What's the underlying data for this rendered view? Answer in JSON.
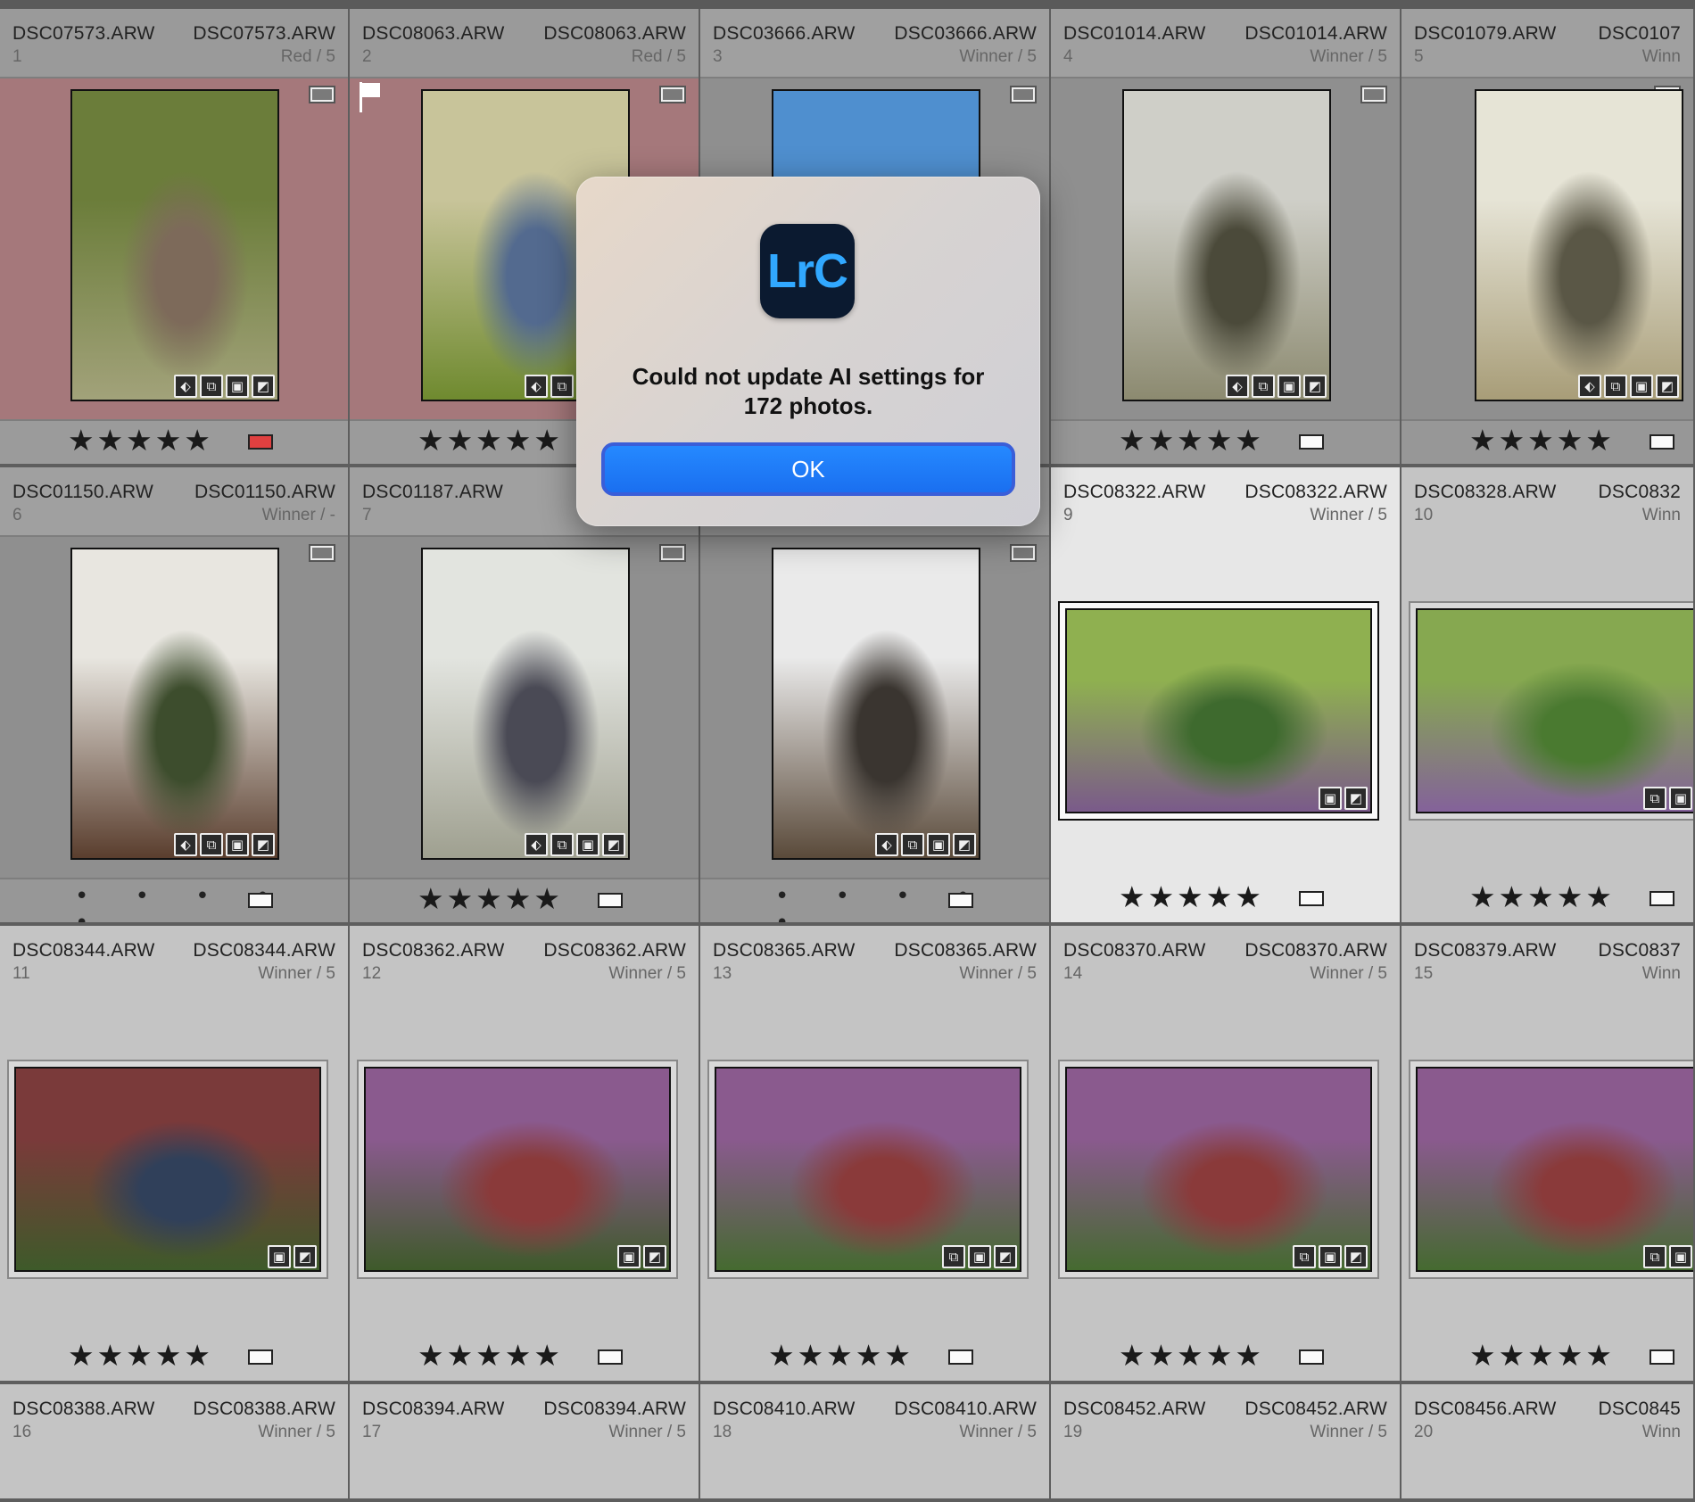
{
  "dialog": {
    "app_icon_text": "LrC",
    "message_line1": "Could not update AI settings for",
    "message_line2": "172 photos.",
    "ok_label": "OK"
  },
  "grid": {
    "cells": [
      {
        "row": 0,
        "col": 0,
        "file": "DSC07573.ARW",
        "file_right": "DSC07573.ARW",
        "index": "1",
        "label": "Red / 5",
        "rating": "★★★★★",
        "footer": "stars",
        "swatch": "red",
        "orientation": "portrait",
        "state": "red",
        "colors": [
          "#6b7d3a",
          "#a2a27a",
          "#7d6a5a"
        ],
        "flagged": false
      },
      {
        "row": 0,
        "col": 1,
        "file": "DSC08063.ARW",
        "file_right": "DSC08063.ARW",
        "index": "2",
        "label": "Red / 5",
        "rating": "★★★★★",
        "footer": "stars",
        "swatch": "",
        "orientation": "portrait",
        "state": "red",
        "colors": [
          "#c8c49a",
          "#6f8a2f",
          "#536a8f"
        ],
        "flagged": true
      },
      {
        "row": 0,
        "col": 2,
        "file": "DSC03666.ARW",
        "file_right": "DSC03666.ARW",
        "index": "3",
        "label": "Winner / 5",
        "rating": "",
        "footer": "none",
        "swatch": "",
        "orientation": "portrait",
        "state": "dark",
        "colors": [
          "#4f8fcf",
          "#2f4a2a",
          "#8a8a80"
        ],
        "flagged": false
      },
      {
        "row": 0,
        "col": 3,
        "file": "DSC01014.ARW",
        "file_right": "DSC01014.ARW",
        "index": "4",
        "label": "Winner / 5",
        "rating": "★★★★★",
        "footer": "stars",
        "swatch": "box",
        "orientation": "portrait",
        "state": "dark",
        "colors": [
          "#cfcfc8",
          "#8c8a70",
          "#4b4a3a"
        ],
        "flagged": false
      },
      {
        "row": 0,
        "col": 4,
        "file": "DSC01079.ARW",
        "file_right": "DSC0107",
        "index": "5",
        "label": "Winn",
        "rating": "★★★★★",
        "footer": "stars",
        "swatch": "box",
        "orientation": "portrait",
        "state": "dark",
        "colors": [
          "#e6e4d6",
          "#a89d78",
          "#5a5746"
        ],
        "flagged": false
      },
      {
        "row": 1,
        "col": 0,
        "file": "DSC01150.ARW",
        "file_right": "DSC01150.ARW",
        "index": "6",
        "label": "Winner / -",
        "rating": "• • • • •",
        "footer": "dots",
        "swatch": "box",
        "orientation": "portrait",
        "state": "dark",
        "colors": [
          "#e8e6e0",
          "#5a3e2e",
          "#3d4d2d"
        ],
        "flagged": false
      },
      {
        "row": 1,
        "col": 1,
        "file": "DSC01187.ARW",
        "file_right": "D",
        "index": "7",
        "label": "",
        "rating": "★★★★★",
        "footer": "stars",
        "swatch": "box",
        "orientation": "portrait",
        "state": "dark",
        "colors": [
          "#e2e4df",
          "#9fa090",
          "#4a4a55"
        ],
        "flagged": false
      },
      {
        "row": 1,
        "col": 2,
        "file": "",
        "file_right": "",
        "index": "",
        "label": "",
        "rating": "• • • • •",
        "footer": "dots",
        "swatch": "box",
        "orientation": "portrait",
        "state": "dark",
        "colors": [
          "#eaeaea",
          "#5a4a3a",
          "#3a3530"
        ],
        "flagged": false
      },
      {
        "row": 1,
        "col": 3,
        "file": "DSC08322.ARW",
        "file_right": "DSC08322.ARW",
        "index": "9",
        "label": "Winner / 5",
        "rating": "★★★★★",
        "footer": "stars",
        "swatch": "box",
        "orientation": "landscape",
        "state": "selected",
        "colors": [
          "#8fb050",
          "#7a5a8a",
          "#3e6a2e"
        ],
        "flagged": false
      },
      {
        "row": 1,
        "col": 4,
        "file": "DSC08328.ARW",
        "file_right": "DSC0832",
        "index": "10",
        "label": "Winn",
        "rating": "★★★★★",
        "footer": "stars",
        "swatch": "box",
        "orientation": "landscape",
        "state": "light",
        "colors": [
          "#86a850",
          "#84629a",
          "#4a7a30"
        ],
        "flagged": false
      },
      {
        "row": 2,
        "col": 0,
        "file": "DSC08344.ARW",
        "file_right": "DSC08344.ARW",
        "index": "11",
        "label": "Winner / 5",
        "rating": "★★★★★",
        "footer": "stars",
        "swatch": "box",
        "orientation": "landscape",
        "state": "light",
        "colors": [
          "#7a3a3a",
          "#3e5a2a",
          "#30405a"
        ],
        "flagged": false
      },
      {
        "row": 2,
        "col": 1,
        "file": "DSC08362.ARW",
        "file_right": "DSC08362.ARW",
        "index": "12",
        "label": "Winner / 5",
        "rating": "★★★★★",
        "footer": "stars",
        "swatch": "box",
        "orientation": "landscape",
        "state": "light",
        "colors": [
          "#8a5a8e",
          "#3e5a2a",
          "#8a3a3a"
        ],
        "flagged": false
      },
      {
        "row": 2,
        "col": 2,
        "file": "DSC08365.ARW",
        "file_right": "DSC08365.ARW",
        "index": "13",
        "label": "Winner / 5",
        "rating": "★★★★★",
        "footer": "stars",
        "swatch": "box",
        "orientation": "landscape",
        "state": "light",
        "colors": [
          "#8a5a8e",
          "#456a30",
          "#8a3a3a"
        ],
        "flagged": false
      },
      {
        "row": 2,
        "col": 3,
        "file": "DSC08370.ARW",
        "file_right": "DSC08370.ARW",
        "index": "14",
        "label": "Winner / 5",
        "rating": "★★★★★",
        "footer": "stars",
        "swatch": "box",
        "orientation": "landscape",
        "state": "light",
        "colors": [
          "#8a5a8e",
          "#456a30",
          "#8a3a3a"
        ],
        "flagged": false
      },
      {
        "row": 2,
        "col": 4,
        "file": "DSC08379.ARW",
        "file_right": "DSC0837",
        "index": "15",
        "label": "Winn",
        "rating": "★★★★★",
        "footer": "stars",
        "swatch": "box",
        "orientation": "landscape",
        "state": "light",
        "colors": [
          "#8a5a8e",
          "#456a30",
          "#8a3a3a"
        ],
        "flagged": false
      },
      {
        "row": 3,
        "col": 0,
        "file": "DSC08388.ARW",
        "file_right": "DSC08388.ARW",
        "index": "16",
        "label": "Winner / 5",
        "rating": "",
        "footer": "none",
        "swatch": "",
        "orientation": "none",
        "state": "light",
        "colors": [],
        "flagged": false
      },
      {
        "row": 3,
        "col": 1,
        "file": "DSC08394.ARW",
        "file_right": "DSC08394.ARW",
        "index": "17",
        "label": "Winner / 5",
        "rating": "",
        "footer": "none",
        "swatch": "",
        "orientation": "none",
        "state": "light",
        "colors": [],
        "flagged": false
      },
      {
        "row": 3,
        "col": 2,
        "file": "DSC08410.ARW",
        "file_right": "DSC08410.ARW",
        "index": "18",
        "label": "Winner / 5",
        "rating": "",
        "footer": "none",
        "swatch": "",
        "orientation": "none",
        "state": "light",
        "colors": [],
        "flagged": false
      },
      {
        "row": 3,
        "col": 3,
        "file": "DSC08452.ARW",
        "file_right": "DSC08452.ARW",
        "index": "19",
        "label": "Winner / 5",
        "rating": "",
        "footer": "none",
        "swatch": "",
        "orientation": "none",
        "state": "light",
        "colors": [],
        "flagged": false
      },
      {
        "row": 3,
        "col": 4,
        "file": "DSC08456.ARW",
        "file_right": "DSC0845",
        "index": "20",
        "label": "Winn",
        "rating": "",
        "footer": "none",
        "swatch": "",
        "orientation": "none",
        "state": "light",
        "colors": [],
        "flagged": false
      }
    ],
    "badge_icons": [
      "tag-icon",
      "crop-icon",
      "collection-icon",
      "develop-icon"
    ],
    "colors": {
      "red_cell_bg": "#a5787b",
      "red_cell_header": "#9a9a9a",
      "dark_cell_bg": "#8f8f8f",
      "dark_cell_header": "#a0a0a0",
      "light_cell_bg": "#c4c4c4",
      "selected_cell_bg": "#e7e7e7",
      "red_label": "#e04040",
      "accent_blue": "#1a6ff0"
    }
  }
}
